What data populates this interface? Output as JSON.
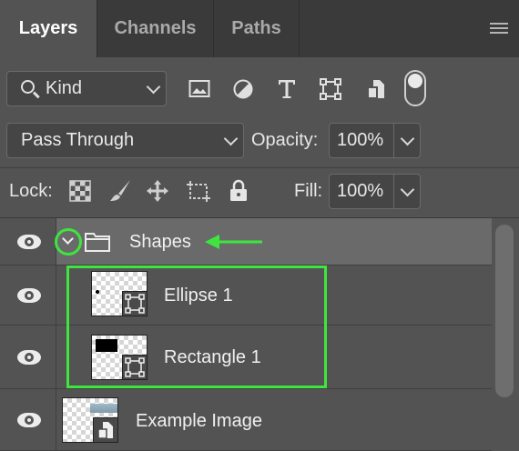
{
  "tabs": [
    {
      "label": "Layers",
      "active": true
    },
    {
      "label": "Channels",
      "active": false
    },
    {
      "label": "Paths",
      "active": false
    }
  ],
  "filter": {
    "kind_label": "Kind",
    "filter_icons": [
      "image-filter-icon",
      "adjustment-filter-icon",
      "type-filter-icon",
      "shape-filter-icon",
      "smart-object-filter-icon"
    ]
  },
  "blend": {
    "mode": "Pass Through",
    "opacity_label": "Opacity:",
    "opacity_value": "100%"
  },
  "lock": {
    "label": "Lock:",
    "icons": [
      "lock-transparent-pixels-icon",
      "lock-image-pixels-icon",
      "lock-position-icon",
      "lock-artboard-icon",
      "lock-all-icon"
    ],
    "fill_label": "Fill:",
    "fill_value": "100%"
  },
  "layers": {
    "group_name": "Shapes",
    "ellipse_name": "Ellipse 1",
    "rect_name": "Rectangle 1",
    "image_name": "Example Image"
  },
  "colors": {
    "highlight": "#3ee53e",
    "panel_bg": "#535353",
    "selected_row": "#6a6a6a"
  }
}
